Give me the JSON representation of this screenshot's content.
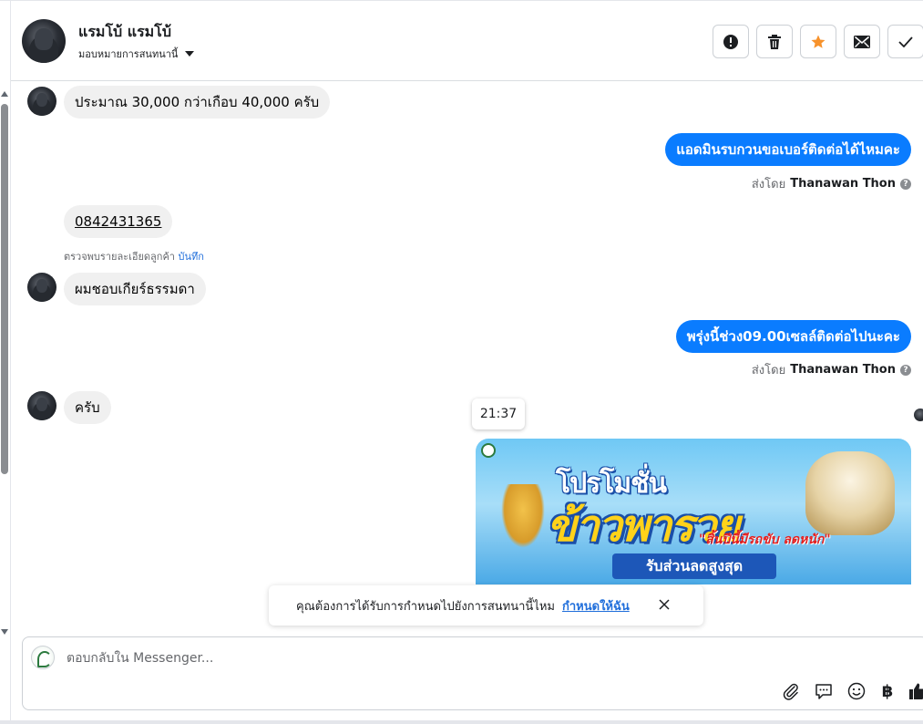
{
  "header": {
    "user_name": "แรมโบ้ แรมโบ้",
    "assign_label": "มอบหมายการสนทนานี้",
    "buttons": [
      "spam-alert",
      "delete",
      "star",
      "mark-unread",
      "done"
    ]
  },
  "messages": [
    {
      "type": "in",
      "text": "ประมาณ 30,000 กว่าเกือบ 40,000 ครับ"
    },
    {
      "type": "out",
      "text": "แอดมินรบกวนขอเบอร์ติดต่อได้ไหมคะ",
      "sent_by_prefix": "ส่งโดย",
      "sent_by_name": "Thanawan Thon"
    },
    {
      "type": "in",
      "text": "0842431365"
    },
    {
      "type": "in",
      "text": "ผมชอบเกียร์ธรรมดา"
    },
    {
      "type": "out",
      "text": "พรุ่งนี้ช่วง09.00เซลล์ติดต่อไปนะคะ",
      "sent_by_prefix": "ส่งโดย",
      "sent_by_name": "Thanawan Thon"
    },
    {
      "type": "in",
      "text": "ครับ"
    }
  ],
  "detect": {
    "text": "ตรวจพบรายละเอียดลูกค้า",
    "link": "บันทึก"
  },
  "time_tooltip": "21:37",
  "promo": {
    "line1": "โปรโมชั่น",
    "line2": "ข้าวพารวย",
    "line3": "\"สิ้นปีนี้มีรถขับ ลดหนัก\"",
    "band": "รับส่วนลดสูงสุด"
  },
  "notice": {
    "text": "คุณต้องการได้รับการกำหนดไปยังการสนทนานี้ไหม",
    "link": "กำหนดให้ฉัน"
  },
  "composer": {
    "placeholder": "ตอบกลับใน Messenger...",
    "currency_symbol": "฿"
  },
  "colors": {
    "outgoing_bubble": "#0a7cff",
    "incoming_bubble": "#f0f0f0",
    "star": "#f7922b",
    "link": "#216fdb"
  }
}
